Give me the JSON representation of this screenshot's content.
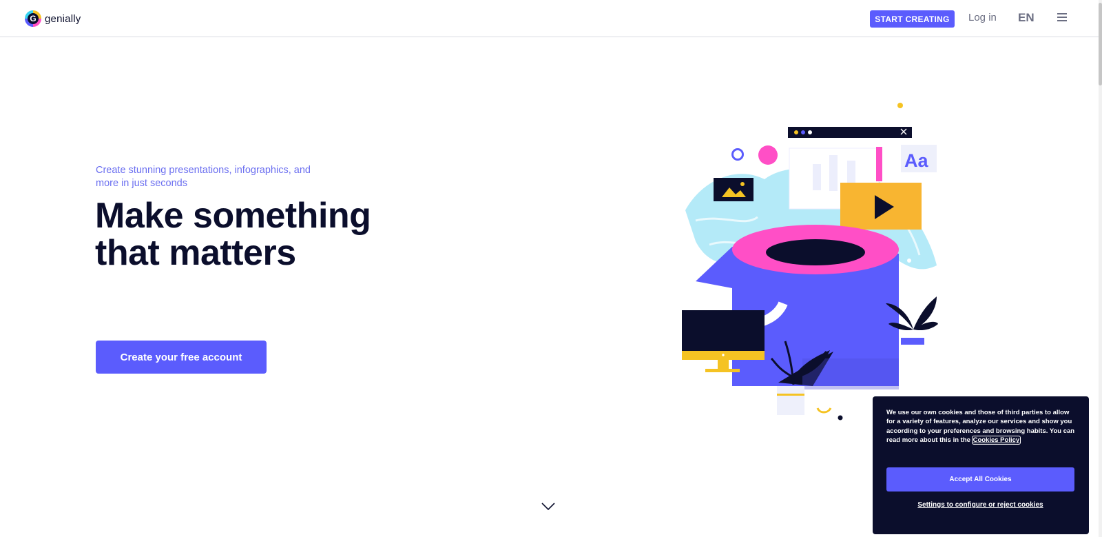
{
  "header": {
    "logo_text": "genially",
    "logo_letter": "G",
    "start_creating": "START CREATING",
    "login": "Log in",
    "language": "EN"
  },
  "hero": {
    "subtitle": "Create stunning presentations, infographics, and more in just seconds",
    "headline": "Make something that matters",
    "cta": "Create your free account"
  },
  "illustration": {
    "badge_text": "Aa"
  },
  "cookie": {
    "text": "We use our own cookies and those of third parties to allow for a variety of features, analyze our services and show you according to your preferences and browsing habits. You can read more about this in the",
    "link": "Cookies Policy",
    "accept": "Accept All Cookies",
    "settings": "Settings to configure or reject cookies"
  },
  "colors": {
    "brand": "#5b5cfd",
    "dark": "#0b0e2c",
    "pink": "#ff4fc6",
    "yellow": "#f5c323",
    "cyan": "#38d3f0",
    "subtitle": "#6a6ef0"
  },
  "icons": [
    "genially-logo-icon",
    "hamburger-menu-icon",
    "chevron-down-icon"
  ]
}
